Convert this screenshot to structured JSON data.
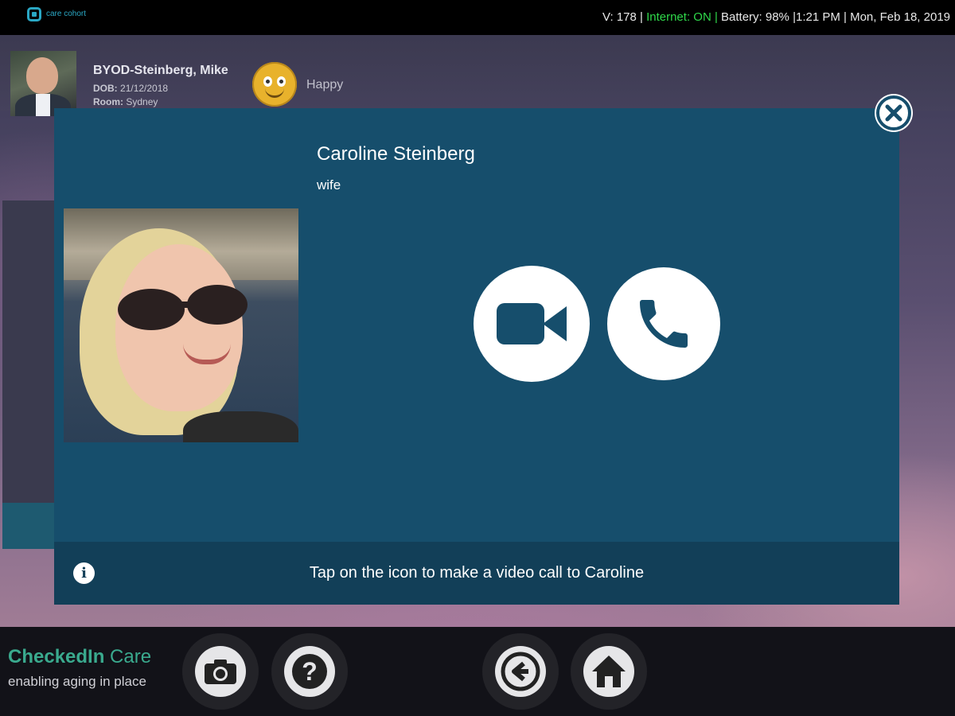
{
  "status": {
    "logo_text": "care cohort",
    "version": "V: 178 |",
    "internet": "Internet: ON |",
    "battery": "Battery: 98%",
    "time": "|1:21 PM",
    "date": "| Mon, Feb 18, 2019",
    "internet_color": "#2fd84a"
  },
  "patient": {
    "name": "BYOD-Steinberg, Mike",
    "dob_label": "DOB:",
    "dob": "21/12/2018",
    "room_label": "Room:",
    "room": "Sydney",
    "mood": "Happy"
  },
  "contact": {
    "name": "Caroline Steinberg",
    "relationship": "wife",
    "video_icon": "video-camera-icon",
    "phone_icon": "phone-icon",
    "close_icon": "close-icon"
  },
  "footer": {
    "info_icon": "info-icon",
    "message": "Tap on the icon to make a video call to Caroline"
  },
  "bottom": {
    "brand_bold": "CheckedIn",
    "brand_rest": " Care",
    "tagline": "enabling aging in place",
    "buttons": [
      "camera-icon",
      "help-icon",
      "back-icon",
      "home-icon"
    ]
  },
  "colors": {
    "modal_bg": "#164e6c",
    "footer_bg": "#123f58",
    "brand": "#3aaa8e",
    "logo": "#2aa7c4"
  }
}
